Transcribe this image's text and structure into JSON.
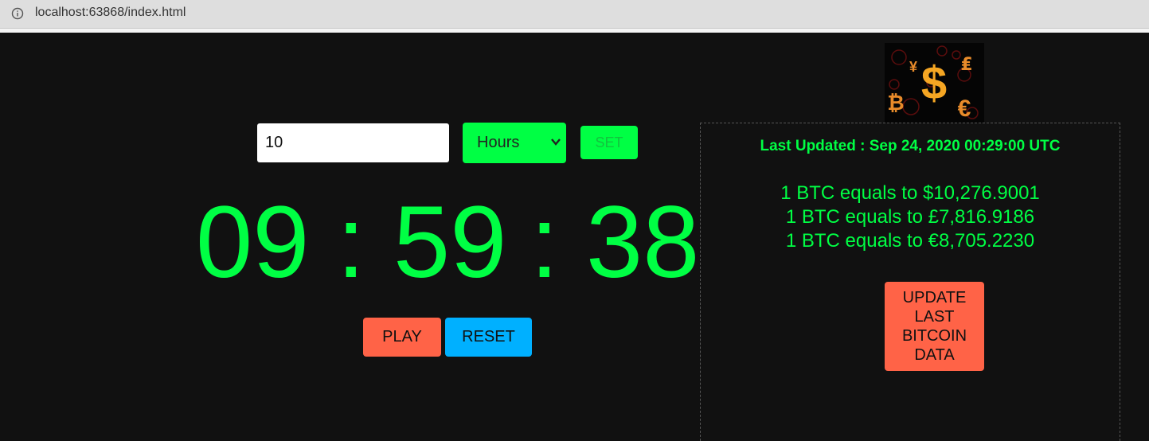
{
  "browser": {
    "url": "localhost:63868/index.html"
  },
  "timer_controls": {
    "input_value": "10",
    "unit_selected": "Hours",
    "set_label": "SET"
  },
  "timer": {
    "hours": "09",
    "minutes": "59",
    "seconds": "38",
    "separator": ":"
  },
  "actions": {
    "play_label": "PLAY",
    "reset_label": "RESET"
  },
  "bitcoin": {
    "last_updated": "Last Updated : Sep 24, 2020 00:29:00 UTC",
    "rates": [
      "1 BTC equals to $10,276.9001",
      "1 BTC equals to £7,816.9186",
      "1 BTC equals to €8,705.2230"
    ],
    "update_lines": [
      "UPDATE",
      "LAST",
      "BITCOIN",
      "DATA"
    ],
    "logo_symbols": {
      "dollar": "$",
      "yen": "¥",
      "pound": "₤",
      "bitcoin": "₿",
      "euro": "€"
    }
  },
  "colors": {
    "accent_green": "#00ff44",
    "button_red": "#ff6347",
    "button_blue": "#00b0ff",
    "background": "#111111"
  }
}
